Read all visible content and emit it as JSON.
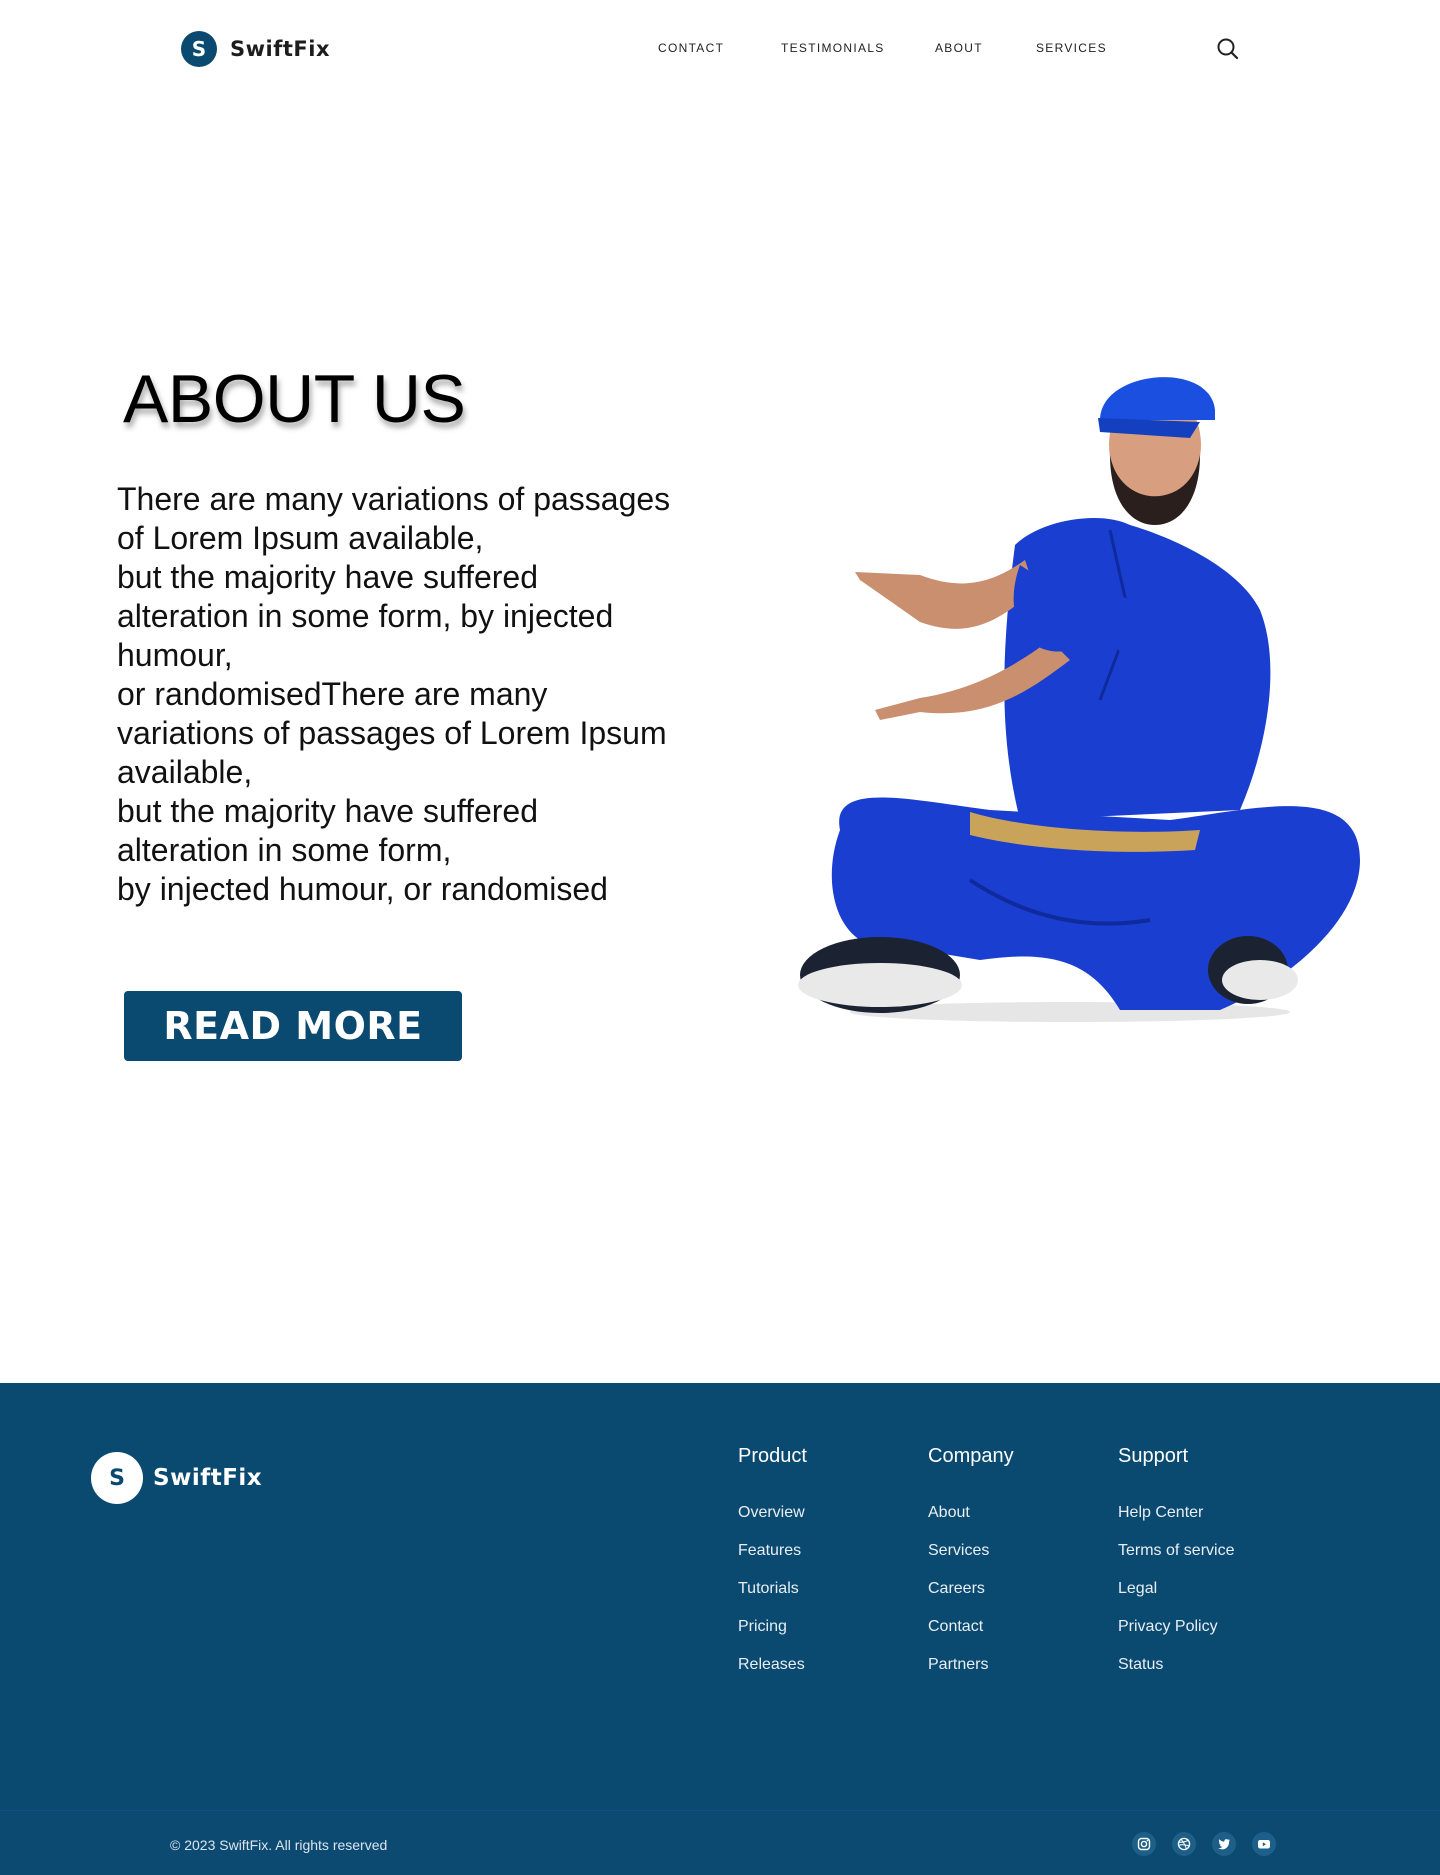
{
  "header": {
    "brand_initial": "S",
    "brand_name": "SwiftFix",
    "nav": [
      "CONTACT",
      "TESTIMONIALS",
      "ABOUT",
      "SERVICES"
    ],
    "search_icon": "search-icon"
  },
  "hero": {
    "title": "ABOUT US",
    "paragraph_lines": [
      "There are many variations of passages",
      "of Lorem Ipsum available,",
      "but the majority have suffered",
      "alteration in some form, by injected",
      "humour,",
      "or randomisedThere are many",
      "variations of passages of Lorem Ipsum",
      "available,",
      "but the majority have suffered",
      "alteration in some form,",
      "by injected humour, or randomised"
    ],
    "button_label": "READ MORE",
    "image": "plumber-pointing-illustration"
  },
  "footer": {
    "brand_initial": "S",
    "brand_name": "SwiftFix",
    "columns": [
      {
        "title": "Product",
        "links": [
          "Overview",
          "Features",
          "Tutorials",
          "Pricing",
          "Releases"
        ]
      },
      {
        "title": "Company",
        "links": [
          "About",
          "Services",
          "Careers",
          "Contact",
          "Partners"
        ]
      },
      {
        "title": "Support",
        "links": [
          "Help Center",
          "Terms of service",
          "Legal",
          "Privacy Policy",
          "Status"
        ]
      }
    ],
    "copyright": "© 2023 SwiftFix. All rights reserved",
    "social_icons": [
      "instagram-icon",
      "dribbble-icon",
      "twitter-icon",
      "youtube-icon"
    ]
  },
  "colors": {
    "brand": "#0b4a70",
    "uniform": "#1a3fd0",
    "background": "#ffffff"
  }
}
